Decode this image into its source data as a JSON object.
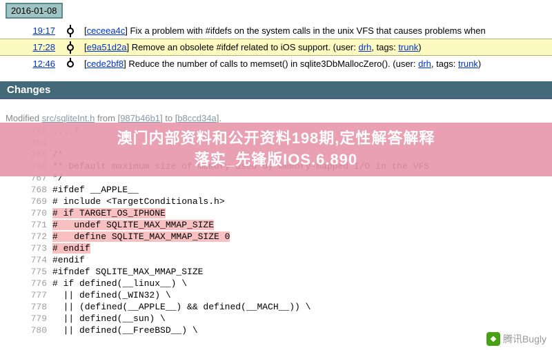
{
  "date": "2016-01-08",
  "timeline": [
    {
      "time": "19:17",
      "hash": "ceceea4c",
      "msg_a": "Fix a problem with #ifdefs on the system calls in the unix VFS that causes problems when",
      "hl": false
    },
    {
      "time": "17:28",
      "hash": "e9a51d2a",
      "msg_a": "Remove an obsolete #ifdef related to iOS support. (user: ",
      "user": "drh",
      "msg_b": ", tags: ",
      "tag": "trunk",
      "msg_c": ")",
      "hl": true
    },
    {
      "time": "12:46",
      "hash": "cede2bf8",
      "msg_a": "Reduce the number of calls to memset() in sqlite3DbMallocZero(). (user: ",
      "user": "drh",
      "msg_b": ", tags: ",
      "tag": "trunk",
      "msg_c": ")",
      "hl": false
    }
  ],
  "section": "Changes",
  "modified": {
    "pre": "Modified ",
    "file": "src/sqliteInt.h",
    "mid": " from [",
    "h1": "987b46b1",
    "mid2": "] to [",
    "h2": "b8ccd34a",
    "end": "]."
  },
  "code": [
    {
      "n": "763",
      "cls": "ctx",
      "t": "....f"
    },
    {
      "n": "764",
      "cls": "",
      "t": ""
    },
    {
      "n": "765",
      "cls": "",
      "t": "/*"
    },
    {
      "n": "766",
      "cls": "",
      "t": "** Default maximum size of memory used by memory-mapped I/O in the VFS"
    },
    {
      "n": "767",
      "cls": "",
      "t": "*/"
    },
    {
      "n": "768",
      "cls": "",
      "t": "#ifdef __APPLE__"
    },
    {
      "n": "769",
      "cls": "",
      "t": "# include <TargetConditionals.h>"
    },
    {
      "n": "770",
      "cls": "del",
      "t": "# if TARGET_OS_IPHONE"
    },
    {
      "n": "771",
      "cls": "del",
      "t": "#   undef SQLITE_MAX_MMAP_SIZE"
    },
    {
      "n": "772",
      "cls": "del",
      "t": "#   define SQLITE_MAX_MMAP_SIZE 0"
    },
    {
      "n": "773",
      "cls": "del",
      "t": "# endif"
    },
    {
      "n": "774",
      "cls": "",
      "t": "#endif"
    },
    {
      "n": "775",
      "cls": "",
      "t": "#ifndef SQLITE_MAX_MMAP_SIZE"
    },
    {
      "n": "776",
      "cls": "",
      "t": "# if defined(__linux__) \\\\"
    },
    {
      "n": "777",
      "cls": "",
      "t": "  || defined(_WIN32) \\\\"
    },
    {
      "n": "778",
      "cls": "",
      "t": "  || (defined(__APPLE__) && defined(__MACH__)) \\\\"
    },
    {
      "n": "779",
      "cls": "",
      "t": "  || defined(__sun) \\\\"
    },
    {
      "n": "780",
      "cls": "",
      "t": "  || defined(__FreeBSD__) \\\\"
    }
  ],
  "overlay": {
    "l1": "澳门内部资料和公开资料198期,定性解答解释",
    "l2": "落实_先锋版IOS.6.890"
  },
  "wm": "腾讯Bugly"
}
